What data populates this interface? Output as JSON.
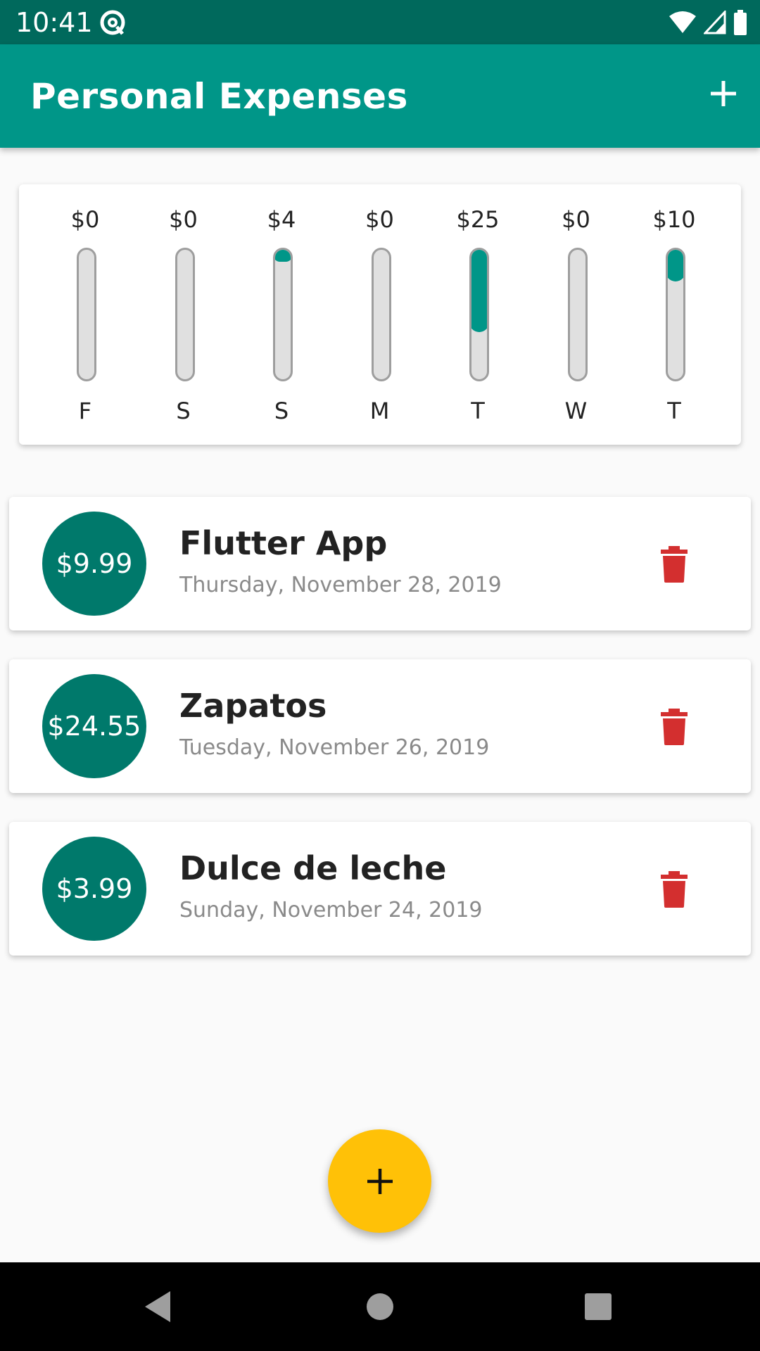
{
  "status_bar": {
    "time": "10:41",
    "icons": [
      "at-sign-icon",
      "wifi-icon",
      "cell-signal-icon",
      "battery-icon"
    ]
  },
  "app_bar": {
    "title": "Personal Expenses",
    "add_icon": "plus-icon",
    "color": "#009688"
  },
  "chart": {
    "bars": [
      {
        "day": "F",
        "amount": "$0",
        "fraction": 0
      },
      {
        "day": "S",
        "amount": "$0",
        "fraction": 0
      },
      {
        "day": "S",
        "amount": "$4",
        "fraction": 0.1
      },
      {
        "day": "M",
        "amount": "$0",
        "fraction": 0
      },
      {
        "day": "T",
        "amount": "$25",
        "fraction": 0.65
      },
      {
        "day": "W",
        "amount": "$0",
        "fraction": 0
      },
      {
        "day": "T",
        "amount": "$10",
        "fraction": 0.26
      }
    ],
    "fill_color": "#009688",
    "track_color": "#e0e0e0"
  },
  "transactions": [
    {
      "amount": "$9.99",
      "title": "Flutter App",
      "date": "Thursday, November 28, 2019"
    },
    {
      "amount": "$24.55",
      "title": "Zapatos",
      "date": "Tuesday, November 26, 2019"
    },
    {
      "amount": "$3.99",
      "title": "Dulce de leche",
      "date": "Sunday, November 24, 2019"
    }
  ],
  "colors": {
    "avatar": "#00796b",
    "delete": "#d32f2f",
    "fab": "#ffc107"
  },
  "fab": {
    "icon": "plus-icon"
  },
  "nav_bar": {
    "icons": [
      "back-icon",
      "home-icon",
      "recents-icon"
    ]
  }
}
